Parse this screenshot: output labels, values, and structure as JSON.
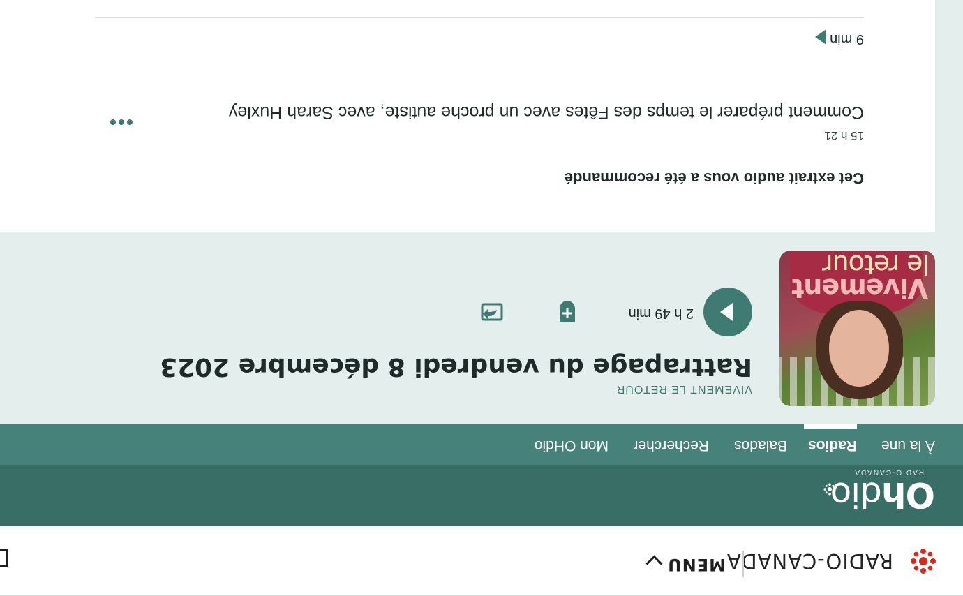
{
  "topbar": {
    "brand": "RADIO-CANADA",
    "menu_label": "MENU"
  },
  "ohdio": {
    "wordmark_bold": "Oh",
    "wordmark_light": "dio",
    "subtitle": "RADIO-CANADA"
  },
  "nav": {
    "items": [
      {
        "label": "À la une"
      },
      {
        "label": "Radios"
      },
      {
        "label": "Balados"
      },
      {
        "label": "Rechercher"
      },
      {
        "label": "Mon OHdio"
      }
    ],
    "active": "Radios"
  },
  "episode": {
    "art_line1": "Vivement",
    "art_line2": "le retour",
    "show": "VIVEMENT LE RETOUR",
    "title": "Rattrapage du vendredi 8 décembre 2023",
    "duration": "2 h 49 min",
    "icons": {
      "play": "play-icon",
      "add": "add-to-list-icon",
      "share": "share-icon"
    }
  },
  "recommendation": {
    "heading": "Cet extrait audio vous a été recommandé",
    "time": "15 h 21",
    "title": "Comment préparer le temps des Fêtes avec un proche autiste, avec Sarah Huxley",
    "duration": "9 min"
  },
  "colors": {
    "header_dark": "#386e66",
    "nav": "#46817a",
    "panel": "#e4eeed",
    "accent": "#3f7b73",
    "rc_red": "#d52b1e"
  }
}
